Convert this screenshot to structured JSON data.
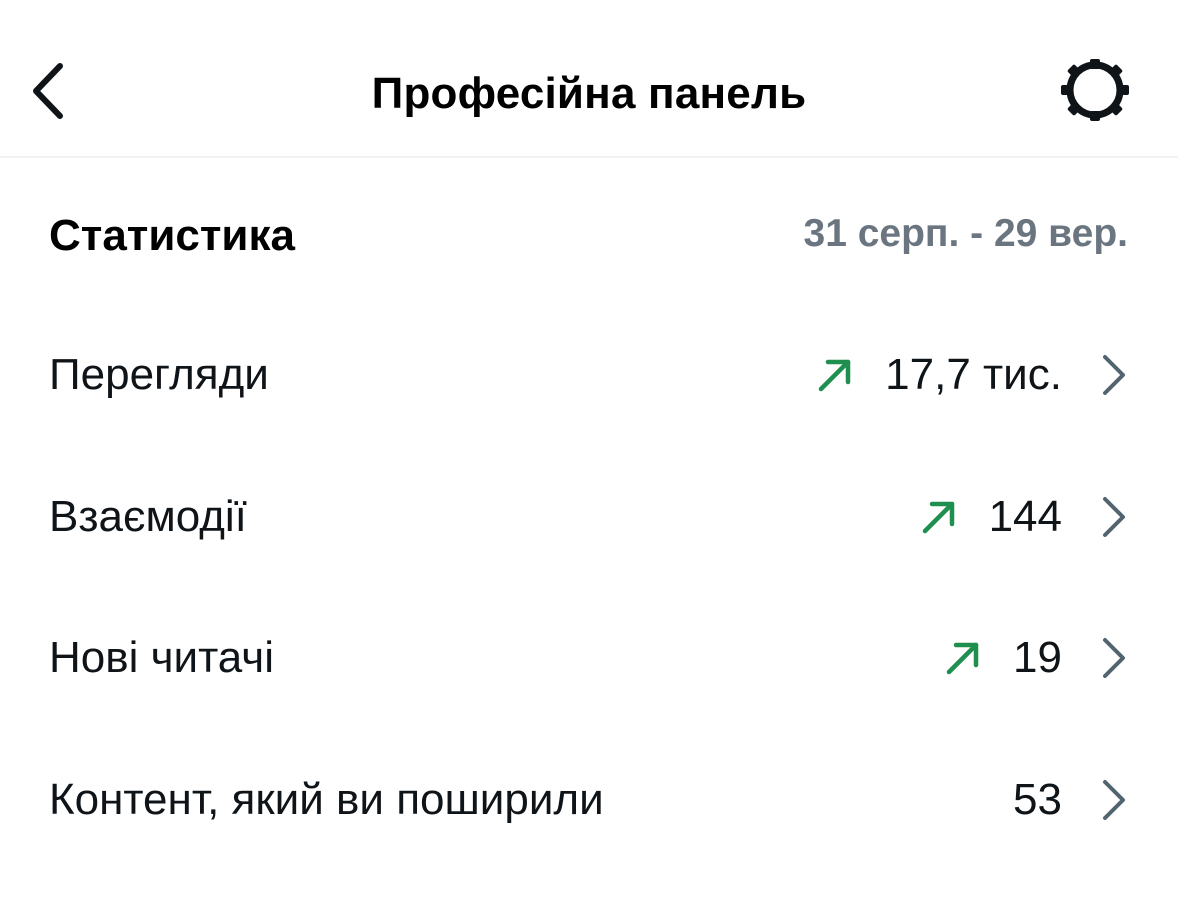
{
  "header": {
    "title": "Професійна панель",
    "back_icon": "chevron-left-icon",
    "settings_icon": "gear-icon"
  },
  "stats": {
    "title": "Статистика",
    "date_range": "31 серп. - 29 вер.",
    "rows": [
      {
        "label": "Перегляди",
        "value": "17,7 тис.",
        "trend": "up"
      },
      {
        "label": "Взаємодії",
        "value": "144",
        "trend": "up"
      },
      {
        "label": "Нові читачі",
        "value": "19",
        "trend": "up"
      },
      {
        "label": "Контент, який ви поширили",
        "value": "53",
        "trend": "none"
      }
    ]
  },
  "colors": {
    "text": "#0f1419",
    "secondary": "#6b7580",
    "trend_up": "#1e8f4e",
    "chevron": "#536471",
    "divider": "#eff1f3"
  }
}
